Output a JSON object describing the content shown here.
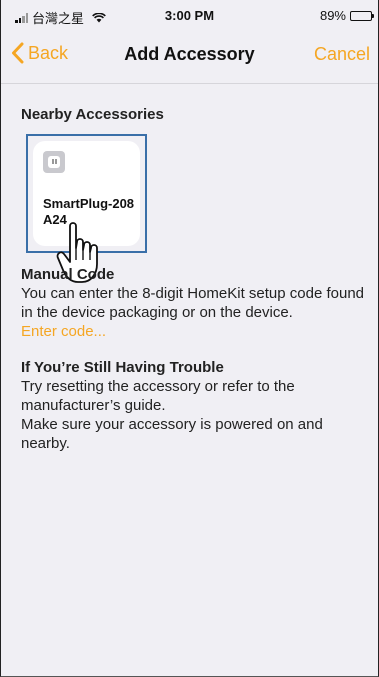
{
  "status_bar": {
    "carrier": "台灣之星",
    "time": "3:00 PM",
    "battery_text": "89%",
    "battery_level": 0.89,
    "icons": [
      "signal-icon",
      "wifi-icon",
      "battery-icon"
    ]
  },
  "nav": {
    "back_label": "Back",
    "title": "Add Accessory",
    "cancel_label": "Cancel"
  },
  "nearby": {
    "title": "Nearby Accessories",
    "accessories": [
      {
        "name": "SmartPlug-208A24",
        "icon": "smart-plug-icon"
      }
    ]
  },
  "manual_code": {
    "title": "Manual Code",
    "body": "You can enter the 8-digit HomeKit setup code found in the device packaging or on the device.",
    "link": "Enter code..."
  },
  "trouble": {
    "title": "If You’re Still Having Trouble",
    "line1": "Try resetting the accessory or refer to the manufacturer’s guide.",
    "line2": "Make sure your accessory is powered on and nearby."
  },
  "colors": {
    "accent": "#f5a623",
    "highlight_frame": "#3a6fa8",
    "background": "#f0eff4"
  }
}
